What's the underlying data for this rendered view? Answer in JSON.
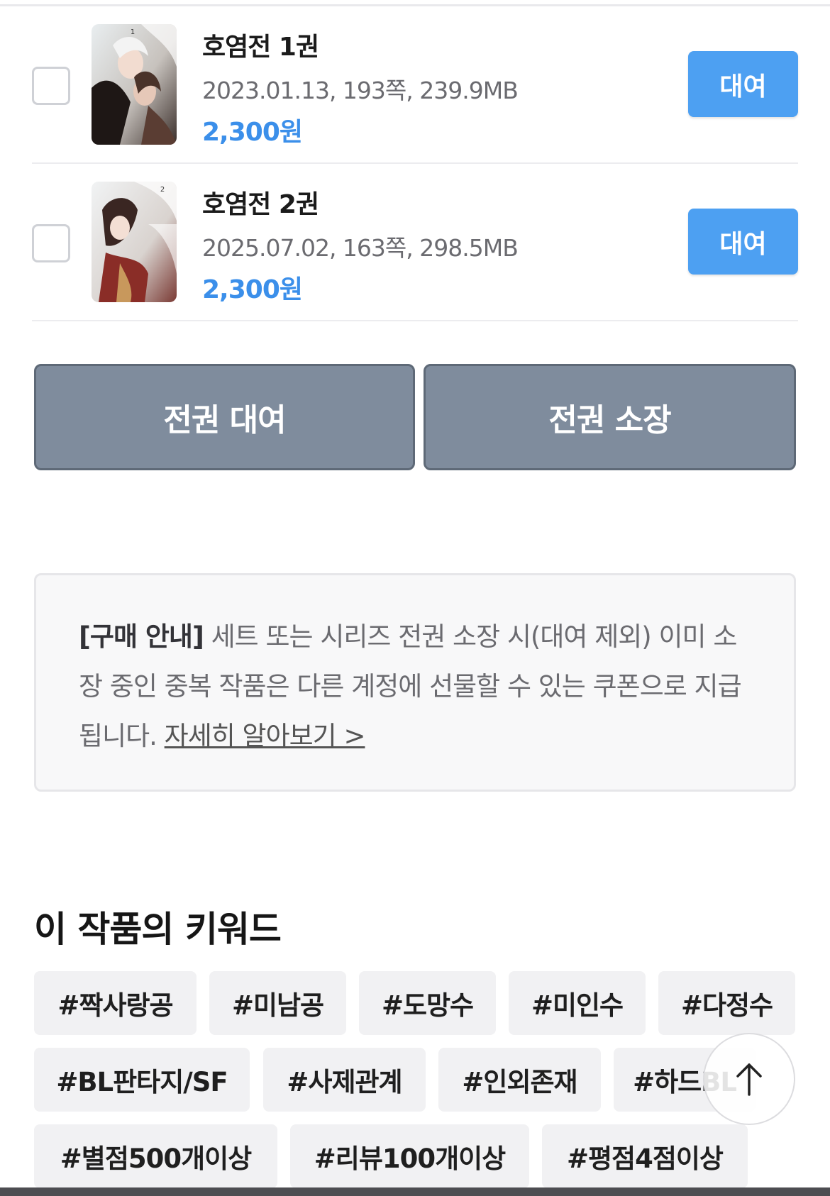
{
  "volumes": [
    {
      "title": "호염전 1권",
      "meta": "2023.01.13, 193쪽, 239.9MB",
      "price": "2,300원",
      "action_label": "대여"
    },
    {
      "title": "호염전 2권",
      "meta": "2025.07.02, 163쪽, 298.5MB",
      "price": "2,300원",
      "action_label": "대여"
    }
  ],
  "bulk_actions": {
    "rent_all_label": "전권 대여",
    "own_all_label": "전권 소장"
  },
  "notice": {
    "label": "[구매 안내]",
    "text": "세트 또는 시리즈 전권 소장 시(대여 제외) 이미 소장 중인 중복 작품은 다른 계정에 선물할 수 있는 쿠폰으로 지급됩니다.",
    "link_text": "자세히 알아보기 >"
  },
  "keywords": {
    "title": "이 작품의 키워드",
    "tags": [
      "#짝사랑공",
      "#미남공",
      "#도망수",
      "#미인수",
      "#다정수",
      "#BL판타지/SF",
      "#사제관계",
      "#인외존재",
      "#하드BL",
      "#별점500개이상",
      "#리뷰100개이상",
      "#평점4점이상"
    ]
  },
  "colors": {
    "accent": "#4da0f2",
    "price": "#3b8fea",
    "bulk_button": "#7f8c9d",
    "tag_background": "#f1f1f3"
  },
  "icons": {
    "scroll_top": "arrow-up-icon"
  }
}
